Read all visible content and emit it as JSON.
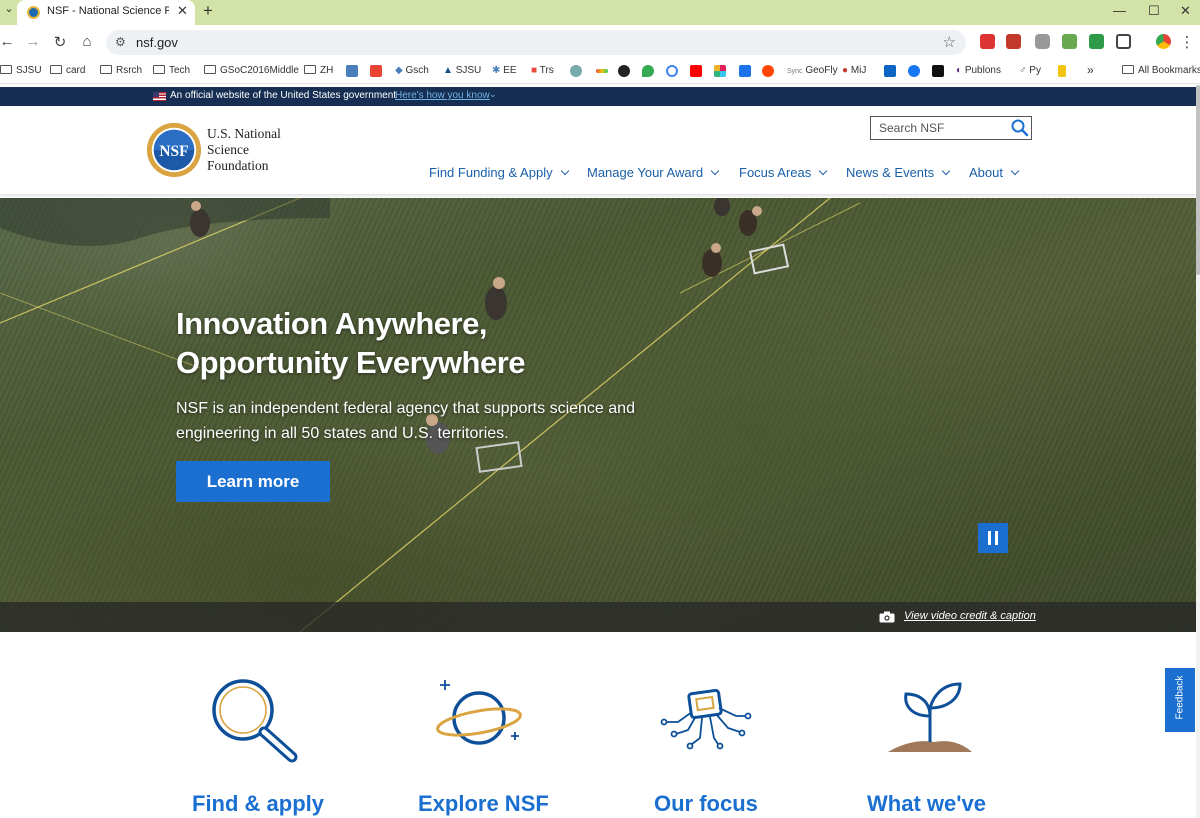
{
  "browser": {
    "tab_title": "NSF - National Science Foundation",
    "url": "nsf.gov",
    "window_controls": {
      "minimize": "—",
      "maximize": "☐",
      "close": "✕"
    },
    "bookmarks": [
      "SJSU",
      "card",
      "Rsrch",
      "Tech",
      "GSoC2016Middle",
      "ZH",
      "Gsch",
      "SJSU",
      "EE",
      "Trs",
      "GeoFly",
      "MiJ",
      "Publons",
      "Py",
      "All Bookmarks"
    ],
    "sync_label": "Sync"
  },
  "gov_banner": {
    "text": "An official website of the United States government",
    "link": "Here's how you know"
  },
  "header": {
    "logo_lines": [
      "U.S. National",
      "Science",
      "Foundation"
    ],
    "logo_seal_text": "NSF",
    "search_placeholder": "Search NSF",
    "nav": [
      "Find Funding & Apply",
      "Manage Your Award",
      "Focus Areas",
      "News & Events",
      "About"
    ]
  },
  "hero": {
    "title_line1": "Innovation Anywhere,",
    "title_line2": "Opportunity Everywhere",
    "text": "NSF is an independent federal agency that supports science and engineering in all 50 states and U.S. territories.",
    "cta": "Learn more",
    "credit_link": "View video credit & caption"
  },
  "cards": [
    {
      "title": "Find & apply",
      "icon": "magnifier-icon"
    },
    {
      "title": "Explore NSF",
      "icon": "planet-icon"
    },
    {
      "title": "Our focus",
      "icon": "microchip-icon"
    },
    {
      "title": "What we've",
      "icon": "seedling-icon"
    }
  ],
  "feedback_label": "Feedback",
  "colors": {
    "primary": "#1a6fd1",
    "banner": "#162e51",
    "nav_text": "#1a5fa8",
    "accent_gold": "#d9a441",
    "tab_strip": "#d3e3a7"
  }
}
